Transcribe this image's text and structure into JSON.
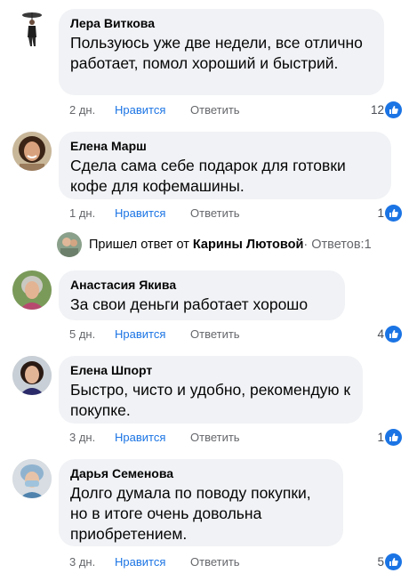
{
  "comments": [
    {
      "author": "Лера Виткова",
      "text": "Пользуюсь уже две недели, все отлично работает, помол хороший и быстрий.",
      "time": "2 дн.",
      "like_label": "Нравится",
      "reply_label": "Ответить",
      "likes": "12"
    },
    {
      "author": "Елена Марш",
      "text": "Сдела сама себе подарок для готовки кофе для кофемашины.",
      "time": "1 дн.",
      "like_label": "Нравится",
      "reply_label": "Ответить",
      "likes": "1"
    },
    {
      "author": "Анастасия Якива",
      "text": "За свои деньги работает хорошо",
      "time": "5 дн.",
      "like_label": "Нравится",
      "reply_label": "Ответить",
      "likes": "4"
    },
    {
      "author": "Елена Шпорт",
      "text": "Быстро, чисто и удобно, рекомендую к покупке.",
      "time": "3 дн.",
      "like_label": "Нравится",
      "reply_label": "Ответить",
      "likes": "1"
    },
    {
      "author": "Дарья Семенова",
      "text": "Долго думала по поводу покупки, но в итоге очень довольна приобретением.",
      "time": "3 дн.",
      "like_label": "Нравится",
      "reply_label": "Ответить",
      "likes": "5"
    }
  ],
  "reply_notice": {
    "prefix": "Пришел ответ от",
    "name": "Карины Лютовой",
    "replies": "· Ответов:1"
  },
  "colors": {
    "accent": "#1b74e4",
    "bubble": "#f0f2f5",
    "muted": "#65676b"
  },
  "icons": {
    "like": "like-thumb-icon"
  }
}
